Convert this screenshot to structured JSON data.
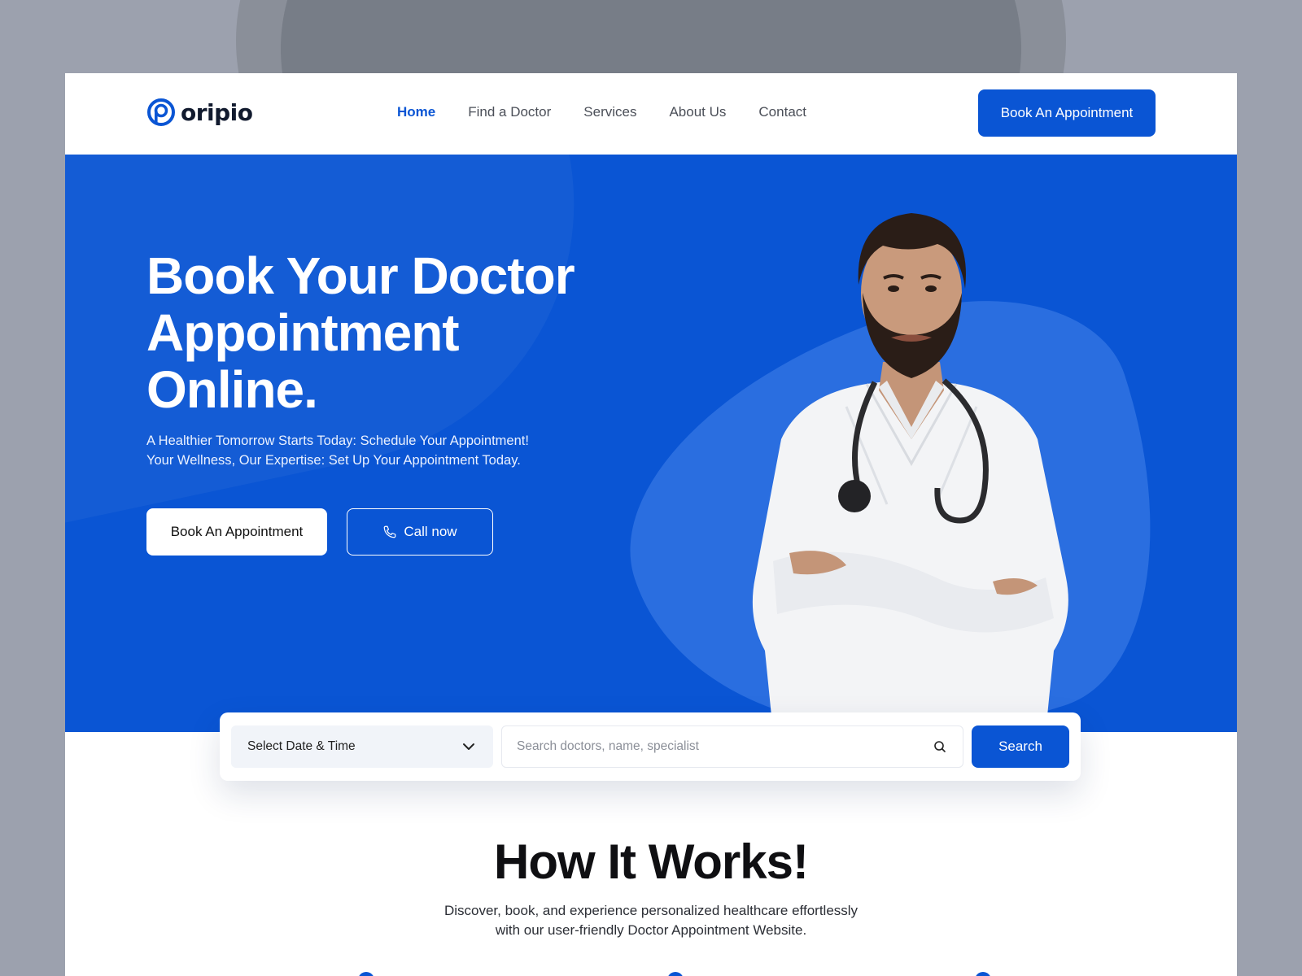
{
  "brand": {
    "name": "oripio",
    "accent": "#0A55D4"
  },
  "nav": {
    "items": [
      {
        "label": "Home",
        "active": true
      },
      {
        "label": "Find a Doctor",
        "active": false
      },
      {
        "label": "Services",
        "active": false
      },
      {
        "label": "About Us",
        "active": false
      },
      {
        "label": "Contact",
        "active": false
      }
    ],
    "cta_label": "Book An Appointment"
  },
  "hero": {
    "title_line1": "Book Your Doctor",
    "title_line2": "Appointment",
    "title_line3": "Online.",
    "subtitle_line1": "A Healthier Tomorrow Starts Today: Schedule Your Appointment!",
    "subtitle_line2": "Your Wellness, Our Expertise: Set Up Your Appointment Today.",
    "primary_button": "Book An Appointment",
    "secondary_button": "Call now",
    "secondary_icon": "phone-icon"
  },
  "search": {
    "date_select_value": "Select Date & Time",
    "query_placeholder": "Search doctors, name, specialist",
    "query_value": "",
    "button_label": "Search"
  },
  "how_it_works": {
    "title": "How It Works!",
    "subtitle_line1": "Discover, book, and experience personalized healthcare effortlessly",
    "subtitle_line2": "with our user-friendly Doctor Appointment Website."
  }
}
